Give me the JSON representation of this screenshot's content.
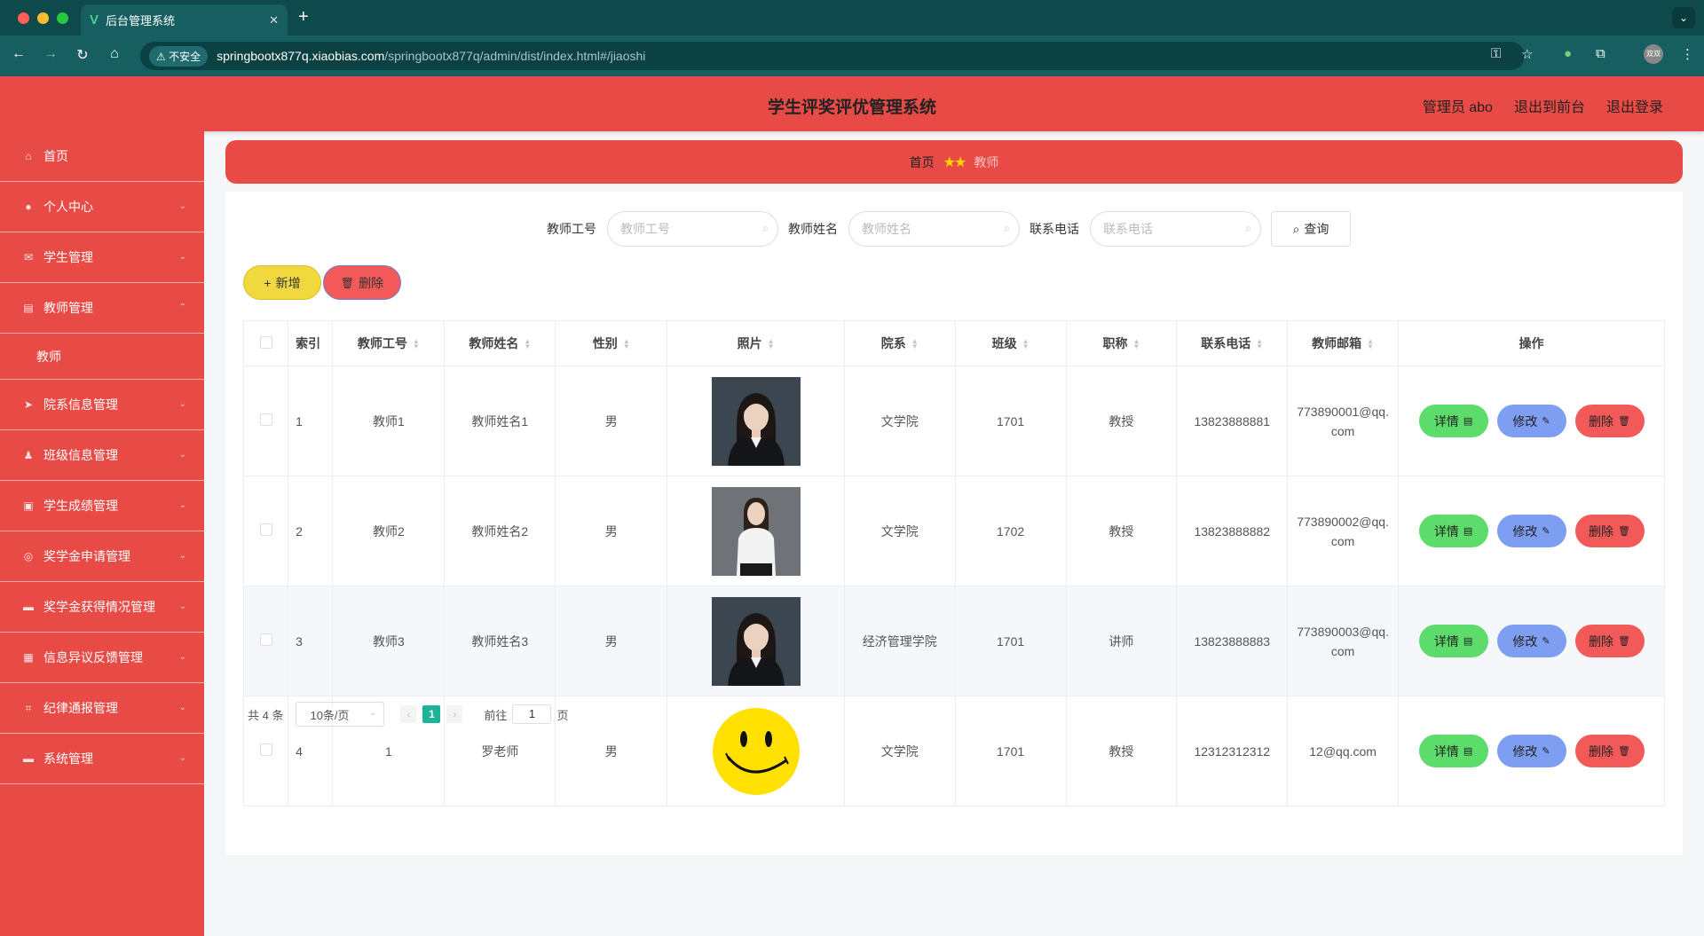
{
  "browser": {
    "tab_title": "后台管理系统",
    "insecure_label": "不安全",
    "url_host": "springbootx877q.xiaobias.com",
    "url_path": "/springbootx877q/admin/dist/index.html#/jiaoshi",
    "profile_label": "双双"
  },
  "header": {
    "title": "学生评奖评优管理系统",
    "user": "管理员 abo",
    "to_front": "退出到前台",
    "logout": "退出登录"
  },
  "sidebar": {
    "items": [
      {
        "label": "首页",
        "icon": "home-icon"
      },
      {
        "label": "个人中心",
        "icon": "user-icon"
      },
      {
        "label": "学生管理",
        "icon": "mail-icon"
      },
      {
        "label": "教师管理",
        "icon": "chart-icon"
      },
      {
        "label": "院系信息管理",
        "icon": "send-icon"
      },
      {
        "label": "班级信息管理",
        "icon": "person-icon"
      },
      {
        "label": "学生成绩管理",
        "icon": "briefcase-icon"
      },
      {
        "label": "奖学金申请管理",
        "icon": "compass-icon"
      },
      {
        "label": "奖学金获得情况管理",
        "icon": "chat-icon"
      },
      {
        "label": "信息异议反馈管理",
        "icon": "grid-icon"
      },
      {
        "label": "纪律通报管理",
        "icon": "crop-icon"
      },
      {
        "label": "系统管理",
        "icon": "chat-icon"
      }
    ],
    "submenu": {
      "label": "教师"
    }
  },
  "breadcrumb": {
    "home": "首页",
    "current": "教师"
  },
  "search": {
    "id_label": "教师工号",
    "id_placeholder": "教师工号",
    "name_label": "教师姓名",
    "name_placeholder": "教师姓名",
    "phone_label": "联系电话",
    "phone_placeholder": "联系电话",
    "button": "查询"
  },
  "actions": {
    "add": "新增",
    "delete": "删除"
  },
  "table": {
    "headers": [
      "索引",
      "教师工号",
      "教师姓名",
      "性别",
      "照片",
      "院系",
      "班级",
      "职称",
      "联系电话",
      "教师邮箱",
      "操作"
    ],
    "rows": [
      {
        "index": "1",
        "id": "教师1",
        "name": "教师姓名1",
        "gender": "男",
        "photo": "portrait-dark",
        "dept": "文学院",
        "class": "1701",
        "title": "教授",
        "phone": "13823888881",
        "email": "773890001@qq.com"
      },
      {
        "index": "2",
        "id": "教师2",
        "name": "教师姓名2",
        "gender": "男",
        "photo": "portrait-light",
        "dept": "文学院",
        "class": "1702",
        "title": "教授",
        "phone": "13823888882",
        "email": "773890002@qq.com"
      },
      {
        "index": "3",
        "id": "教师3",
        "name": "教师姓名3",
        "gender": "男",
        "photo": "portrait-dark",
        "dept": "经济管理学院",
        "class": "1701",
        "title": "讲师",
        "phone": "13823888883",
        "email": "773890003@qq.com"
      },
      {
        "index": "4",
        "id": "1",
        "name": "罗老师",
        "gender": "男",
        "photo": "smiley",
        "dept": "文学院",
        "class": "1701",
        "title": "教授",
        "phone": "12312312312",
        "email": "12@qq.com"
      }
    ],
    "ops": {
      "detail": "详情",
      "edit": "修改",
      "delete": "删除"
    }
  },
  "pager": {
    "total": "共 4 条",
    "page_size": "10条/页",
    "current": "1",
    "goto_label": "前往",
    "goto_value": "1",
    "page_unit": "页"
  },
  "colors": {
    "accent": "#e84a45",
    "chrome": "#165e60",
    "pager_active": "#1db396"
  }
}
